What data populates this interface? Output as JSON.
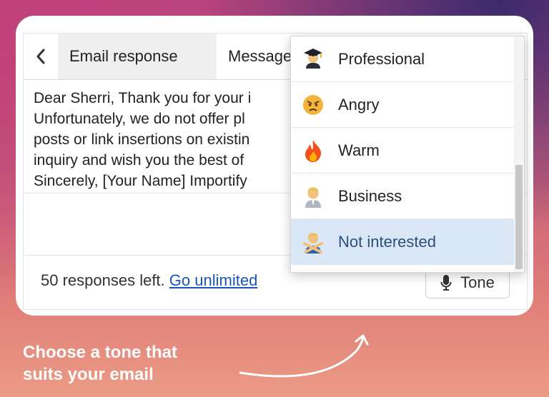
{
  "tabs": {
    "back_label": "‹",
    "items": [
      {
        "label": "Email response"
      },
      {
        "label": "Message"
      }
    ],
    "clipped_tail": "e"
  },
  "editor": {
    "text": "Dear Sherri, Thank you for your i… Unfortunately, we do not offer pl… posts or link insertions on existin… inquiry and wish you the best of… Sincerely, [Your Name] Importify",
    "lines": [
      "Dear Sherri, Thank you for your i",
      "Unfortunately, we do not offer pl",
      "posts or link insertions on existin",
      "inquiry and wish you the best of",
      "Sincerely, [Your Name] Importify"
    ]
  },
  "footer": {
    "responses_text": "50 responses left.",
    "link_text": "Go unlimited",
    "tone_label": "Tone"
  },
  "dropdown": {
    "selected": "Not interested",
    "options": [
      {
        "label": "Professional",
        "icon": "graduate-person-icon"
      },
      {
        "label": "Angry",
        "icon": "angry-face-icon"
      },
      {
        "label": "Warm",
        "icon": "fire-icon"
      },
      {
        "label": "Business",
        "icon": "business-person-icon"
      },
      {
        "label": "Not interested",
        "icon": "crossed-arms-person-icon"
      }
    ]
  },
  "caption": {
    "line1": "Choose a tone that",
    "line2": "suits your email"
  },
  "colors": {
    "link": "#1a56b8",
    "selected_bg": "#d9e7f7",
    "selected_text": "#2c4f7c"
  }
}
